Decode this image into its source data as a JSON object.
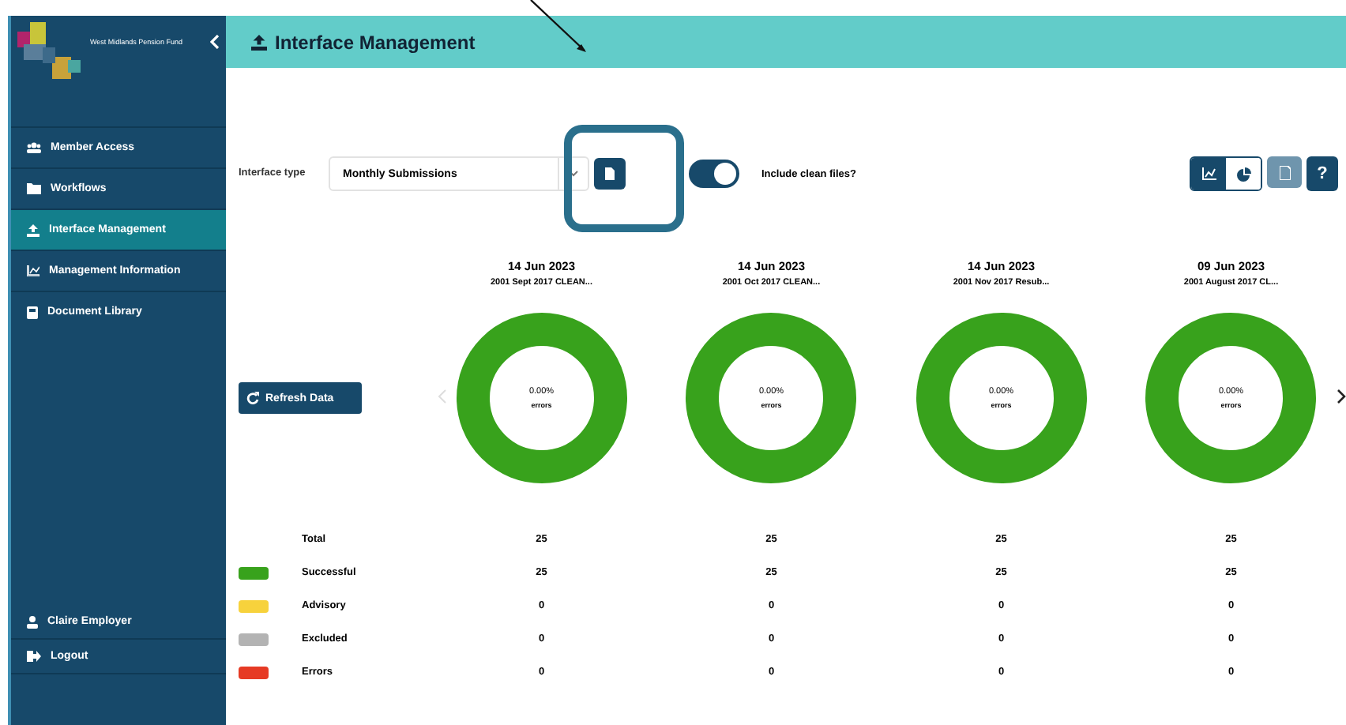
{
  "sidebar": {
    "logo_text": "West Midlands Pension Fund",
    "items": [
      {
        "kind": "users",
        "label": "Member Access",
        "selected": false
      },
      {
        "kind": "folder",
        "label": "Workflows",
        "selected": false
      },
      {
        "kind": "upload",
        "label": "Interface Management",
        "selected": true
      },
      {
        "kind": "chart",
        "label": "Management Information",
        "selected": false
      },
      {
        "kind": "book",
        "label": "Document Library",
        "selected": false
      }
    ],
    "footer_items": [
      {
        "kind": "user",
        "label": "Claire Employer"
      },
      {
        "kind": "logout",
        "label": "Logout"
      }
    ]
  },
  "header": {
    "title": "Interface Management"
  },
  "filter": {
    "label": "Interface type",
    "value": "Monthly Submissions",
    "toggle_on": true,
    "toggle_label": "Include clean files?"
  },
  "view_buttons": [
    {
      "kind": "line-chart",
      "selected": false
    },
    {
      "kind": "pie",
      "selected": true
    }
  ],
  "report_button": {
    "disabled": true
  },
  "help_button": "?",
  "refresh_button": "Refresh Data",
  "submissions": [
    {
      "date": "14 Jun 2023",
      "file": "2001 Sept 2017 CLEAN...",
      "percent": "0.00%",
      "caption": "errors"
    },
    {
      "date": "14 Jun 2023",
      "file": "2001 Oct 2017 CLEAN...",
      "percent": "0.00%",
      "caption": "errors"
    },
    {
      "date": "14 Jun 2023",
      "file": "2001 Nov 2017 Resub...",
      "percent": "0.00%",
      "caption": "errors"
    },
    {
      "date": "09 Jun 2023",
      "file": "2001 August 2017 CL...",
      "percent": "0.00%",
      "caption": "errors"
    }
  ],
  "summary": [
    {
      "label": "Total",
      "values": [
        "25",
        "25",
        "25",
        "25"
      ]
    },
    {
      "label": "Successful",
      "color": "#38a21c",
      "values": [
        "25",
        "25",
        "25",
        "25"
      ]
    },
    {
      "label": "Advisory",
      "color": "#f7d23c",
      "values": [
        "0",
        "0",
        "0",
        "0"
      ]
    },
    {
      "label": "Excluded",
      "color": "#b3b3b3",
      "values": [
        "0",
        "0",
        "0",
        "0"
      ]
    },
    {
      "label": "Errors",
      "color": "#e63a24",
      "values": [
        "0",
        "0",
        "0",
        "0"
      ]
    }
  ]
}
